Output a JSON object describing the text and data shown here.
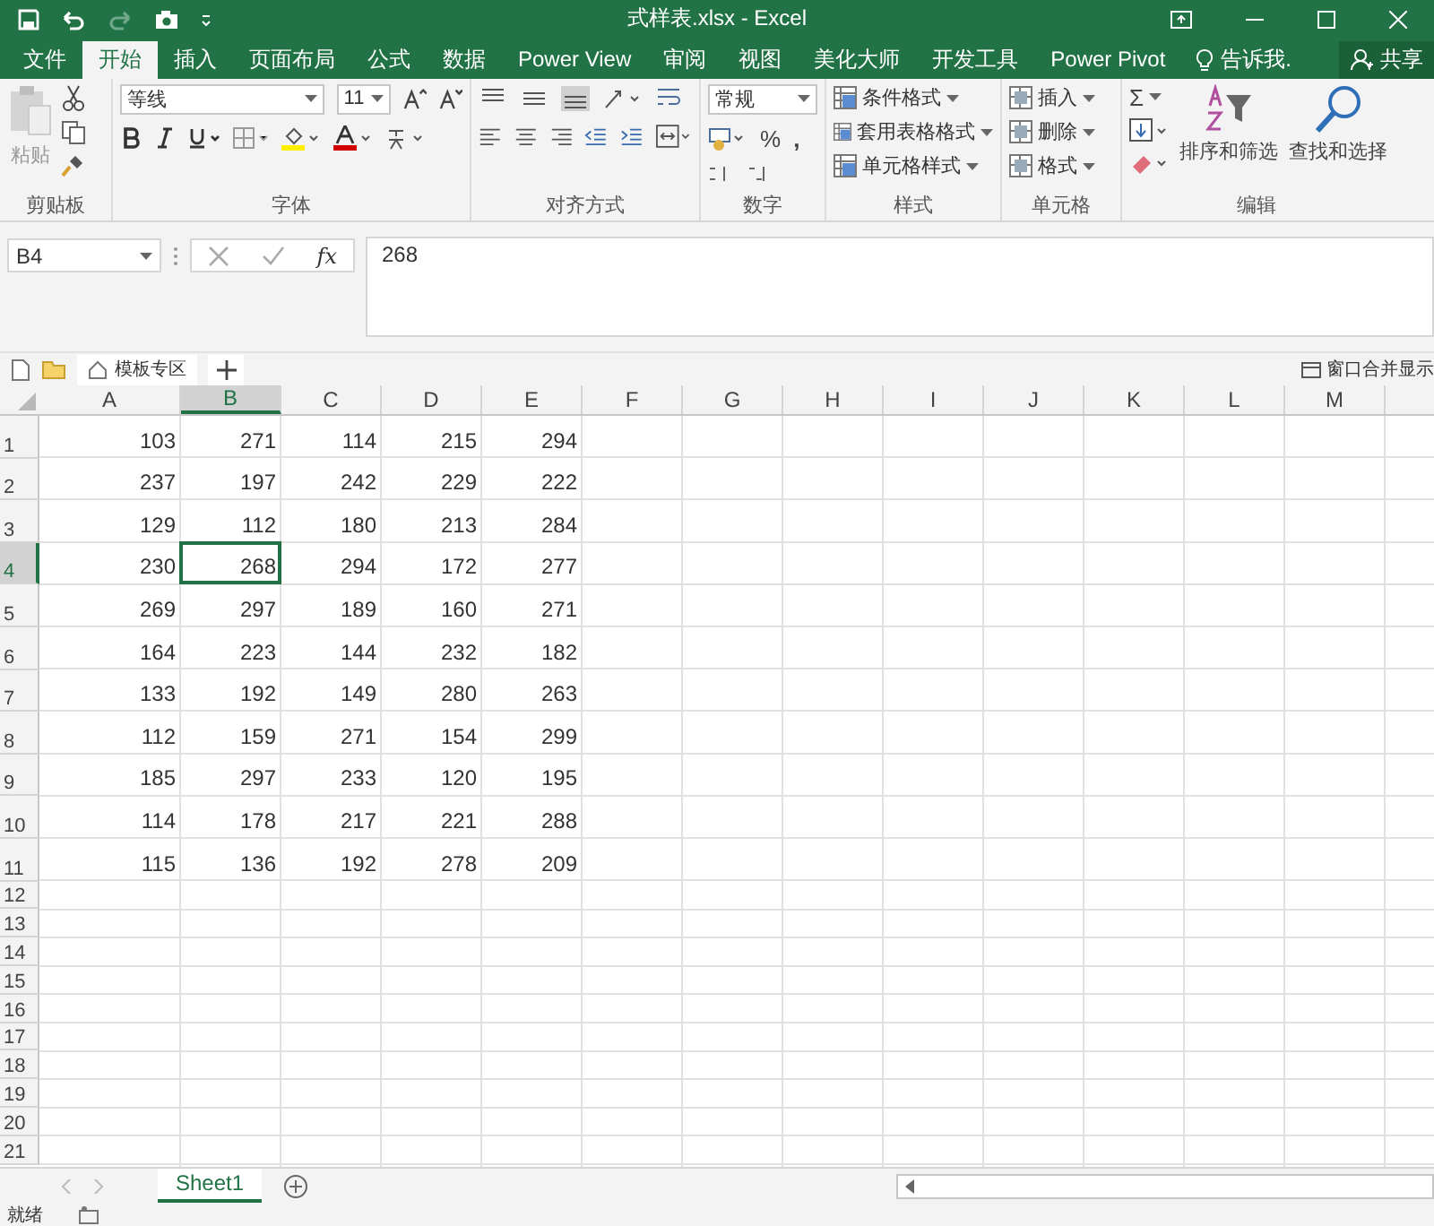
{
  "window": {
    "title": "式样表.xlsx - Excel"
  },
  "tabs": [
    {
      "label": "文件",
      "selected": false
    },
    {
      "label": "开始",
      "selected": true
    },
    {
      "label": "插入",
      "selected": false
    },
    {
      "label": "页面布局",
      "selected": false
    },
    {
      "label": "公式",
      "selected": false
    },
    {
      "label": "数据",
      "selected": false
    },
    {
      "label": "Power View",
      "selected": false
    },
    {
      "label": "审阅",
      "selected": false
    },
    {
      "label": "视图",
      "selected": false
    },
    {
      "label": "美化大师",
      "selected": false
    },
    {
      "label": "开发工具",
      "selected": false
    },
    {
      "label": "Power Pivot",
      "selected": false
    }
  ],
  "tell_me": {
    "placeholder": "告诉我."
  },
  "share_button": "共享",
  "ribbon": {
    "clipboard": {
      "paste": "粘贴",
      "name": "剪贴板"
    },
    "font": {
      "font_name": "等线",
      "font_size": "11",
      "name": "字体"
    },
    "alignment": {
      "name": "对齐方式"
    },
    "number": {
      "format": "常规",
      "percent": "%",
      "comma": ",",
      "name": "数字"
    },
    "styles": {
      "items": [
        "条件格式",
        "套用表格格式",
        "单元格样式"
      ],
      "name": "样式"
    },
    "cells": {
      "items": [
        "插入",
        "删除",
        "格式"
      ],
      "name": "单元格"
    },
    "editing": {
      "sum": "Σ",
      "items": [
        "排序和筛选",
        "查找和选择"
      ],
      "name": "编辑"
    }
  },
  "formula_bar": {
    "name_box": "B4",
    "fx": "fx",
    "value": "268"
  },
  "template_bar": {
    "tab": "模板专区",
    "merge_windows": "窗口合并显示"
  },
  "sheet": {
    "columns": [
      {
        "label": "A",
        "selected": false
      },
      {
        "label": "B",
        "selected": true
      },
      {
        "label": "C",
        "selected": false
      },
      {
        "label": "D",
        "selected": false
      },
      {
        "label": "E",
        "selected": false
      },
      {
        "label": "F",
        "selected": false
      },
      {
        "label": "G",
        "selected": false
      },
      {
        "label": "H",
        "selected": false
      },
      {
        "label": "I",
        "selected": false
      },
      {
        "label": "J",
        "selected": false
      },
      {
        "label": "K",
        "selected": false
      },
      {
        "label": "L",
        "selected": false
      },
      {
        "label": "M",
        "selected": false
      }
    ],
    "rows": [
      {
        "label": "1",
        "selected": false,
        "cells": [
          {
            "value": "103",
            "selected": false
          },
          {
            "value": "271",
            "selected": false
          },
          {
            "value": "114",
            "selected": false
          },
          {
            "value": "215",
            "selected": false
          },
          {
            "value": "294",
            "selected": false
          }
        ]
      },
      {
        "label": "2",
        "selected": false,
        "cells": [
          {
            "value": "237",
            "selected": false
          },
          {
            "value": "197",
            "selected": false
          },
          {
            "value": "242",
            "selected": false
          },
          {
            "value": "229",
            "selected": false
          },
          {
            "value": "222",
            "selected": false
          }
        ]
      },
      {
        "label": "3",
        "selected": false,
        "cells": [
          {
            "value": "129",
            "selected": false
          },
          {
            "value": "112",
            "selected": false
          },
          {
            "value": "180",
            "selected": false
          },
          {
            "value": "213",
            "selected": false
          },
          {
            "value": "284",
            "selected": false
          }
        ]
      },
      {
        "label": "4",
        "selected": true,
        "cells": [
          {
            "value": "230",
            "selected": false
          },
          {
            "value": "268",
            "selected": true
          },
          {
            "value": "294",
            "selected": false
          },
          {
            "value": "172",
            "selected": false
          },
          {
            "value": "277",
            "selected": false
          }
        ]
      },
      {
        "label": "5",
        "selected": false,
        "cells": [
          {
            "value": "269",
            "selected": false
          },
          {
            "value": "297",
            "selected": false
          },
          {
            "value": "189",
            "selected": false
          },
          {
            "value": "160",
            "selected": false
          },
          {
            "value": "271",
            "selected": false
          }
        ]
      },
      {
        "label": "6",
        "selected": false,
        "cells": [
          {
            "value": "164",
            "selected": false
          },
          {
            "value": "223",
            "selected": false
          },
          {
            "value": "144",
            "selected": false
          },
          {
            "value": "232",
            "selected": false
          },
          {
            "value": "182",
            "selected": false
          }
        ]
      },
      {
        "label": "7",
        "selected": false,
        "cells": [
          {
            "value": "133",
            "selected": false
          },
          {
            "value": "192",
            "selected": false
          },
          {
            "value": "149",
            "selected": false
          },
          {
            "value": "280",
            "selected": false
          },
          {
            "value": "263",
            "selected": false
          }
        ]
      },
      {
        "label": "8",
        "selected": false,
        "cells": [
          {
            "value": "112",
            "selected": false
          },
          {
            "value": "159",
            "selected": false
          },
          {
            "value": "271",
            "selected": false
          },
          {
            "value": "154",
            "selected": false
          },
          {
            "value": "299",
            "selected": false
          }
        ]
      },
      {
        "label": "9",
        "selected": false,
        "cells": [
          {
            "value": "185",
            "selected": false
          },
          {
            "value": "297",
            "selected": false
          },
          {
            "value": "233",
            "selected": false
          },
          {
            "value": "120",
            "selected": false
          },
          {
            "value": "195",
            "selected": false
          }
        ]
      },
      {
        "label": "10",
        "selected": false,
        "cells": [
          {
            "value": "114",
            "selected": false
          },
          {
            "value": "178",
            "selected": false
          },
          {
            "value": "217",
            "selected": false
          },
          {
            "value": "221",
            "selected": false
          },
          {
            "value": "288",
            "selected": false
          }
        ]
      },
      {
        "label": "11",
        "selected": false,
        "cells": [
          {
            "value": "115",
            "selected": false
          },
          {
            "value": "136",
            "selected": false
          },
          {
            "value": "192",
            "selected": false
          },
          {
            "value": "278",
            "selected": false
          },
          {
            "value": "209",
            "selected": false
          }
        ]
      },
      {
        "label": "12",
        "selected": false
      },
      {
        "label": "13",
        "selected": false
      },
      {
        "label": "14",
        "selected": false
      },
      {
        "label": "15",
        "selected": false
      },
      {
        "label": "16",
        "selected": false
      },
      {
        "label": "17",
        "selected": false
      },
      {
        "label": "18",
        "selected": false
      },
      {
        "label": "19",
        "selected": false
      },
      {
        "label": "20",
        "selected": false
      },
      {
        "label": "21",
        "selected": false
      }
    ]
  },
  "sheet_tabs": [
    {
      "label": "Sheet1",
      "selected": true
    }
  ],
  "status_bar": {
    "status": "就绪"
  }
}
